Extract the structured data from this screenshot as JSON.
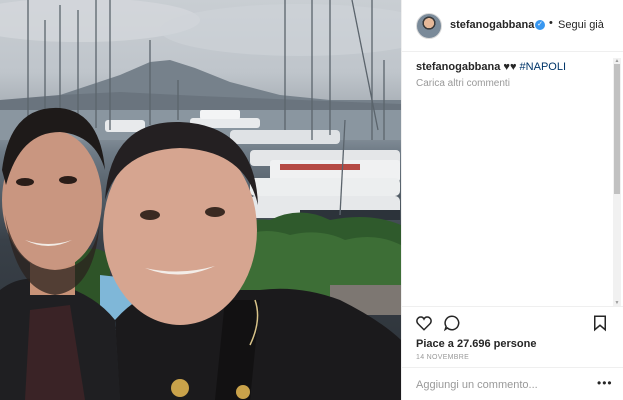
{
  "header": {
    "username": "stefanogabbana",
    "separator": "•",
    "follow_label": "Segui già",
    "verified_icon": "verified-badge-icon"
  },
  "caption": {
    "username": "stefanogabbana",
    "hearts": "♥♥",
    "hashtag": "#NAPOLI"
  },
  "load_more_label": "Carica altri commenti",
  "actions": {
    "like_icon": "heart-icon",
    "comment_icon": "comment-icon",
    "save_icon": "bookmark-icon"
  },
  "likes_text": "Piace a 27.696 persone",
  "date_text": "14 NOVEMBRE",
  "comment_placeholder": "Aggiungi un commento...",
  "more_options_label": "•••",
  "colors": {
    "text": "#262626",
    "muted": "#999999",
    "hashtag": "#003569",
    "verified": "#3897f0",
    "border": "#efefef"
  }
}
